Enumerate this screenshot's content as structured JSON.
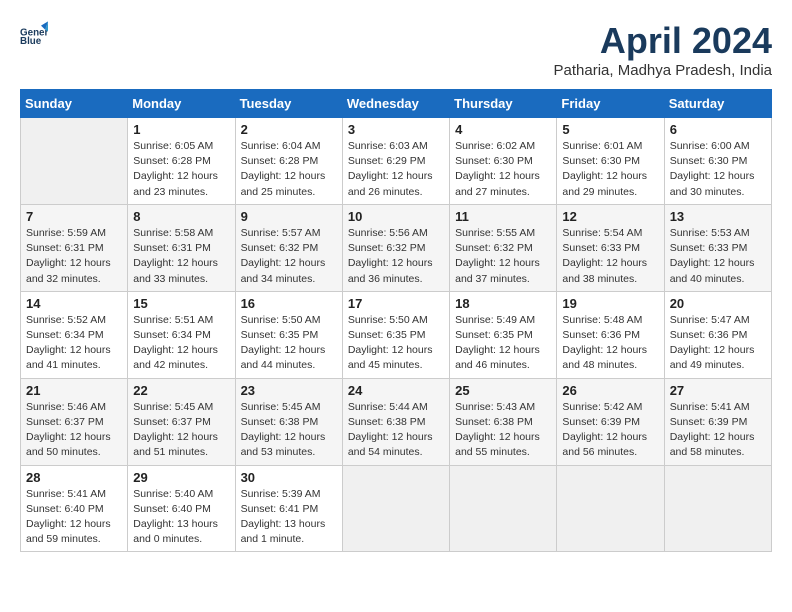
{
  "header": {
    "logo_line1": "General",
    "logo_line2": "Blue",
    "month": "April 2024",
    "location": "Patharia, Madhya Pradesh, India"
  },
  "weekdays": [
    "Sunday",
    "Monday",
    "Tuesday",
    "Wednesday",
    "Thursday",
    "Friday",
    "Saturday"
  ],
  "weeks": [
    [
      {
        "day": "",
        "empty": true
      },
      {
        "day": "1",
        "sunrise": "Sunrise: 6:05 AM",
        "sunset": "Sunset: 6:28 PM",
        "daylight": "Daylight: 12 hours and 23 minutes."
      },
      {
        "day": "2",
        "sunrise": "Sunrise: 6:04 AM",
        "sunset": "Sunset: 6:28 PM",
        "daylight": "Daylight: 12 hours and 25 minutes."
      },
      {
        "day": "3",
        "sunrise": "Sunrise: 6:03 AM",
        "sunset": "Sunset: 6:29 PM",
        "daylight": "Daylight: 12 hours and 26 minutes."
      },
      {
        "day": "4",
        "sunrise": "Sunrise: 6:02 AM",
        "sunset": "Sunset: 6:30 PM",
        "daylight": "Daylight: 12 hours and 27 minutes."
      },
      {
        "day": "5",
        "sunrise": "Sunrise: 6:01 AM",
        "sunset": "Sunset: 6:30 PM",
        "daylight": "Daylight: 12 hours and 29 minutes."
      },
      {
        "day": "6",
        "sunrise": "Sunrise: 6:00 AM",
        "sunset": "Sunset: 6:30 PM",
        "daylight": "Daylight: 12 hours and 30 minutes."
      }
    ],
    [
      {
        "day": "7",
        "sunrise": "Sunrise: 5:59 AM",
        "sunset": "Sunset: 6:31 PM",
        "daylight": "Daylight: 12 hours and 32 minutes."
      },
      {
        "day": "8",
        "sunrise": "Sunrise: 5:58 AM",
        "sunset": "Sunset: 6:31 PM",
        "daylight": "Daylight: 12 hours and 33 minutes."
      },
      {
        "day": "9",
        "sunrise": "Sunrise: 5:57 AM",
        "sunset": "Sunset: 6:32 PM",
        "daylight": "Daylight: 12 hours and 34 minutes."
      },
      {
        "day": "10",
        "sunrise": "Sunrise: 5:56 AM",
        "sunset": "Sunset: 6:32 PM",
        "daylight": "Daylight: 12 hours and 36 minutes."
      },
      {
        "day": "11",
        "sunrise": "Sunrise: 5:55 AM",
        "sunset": "Sunset: 6:32 PM",
        "daylight": "Daylight: 12 hours and 37 minutes."
      },
      {
        "day": "12",
        "sunrise": "Sunrise: 5:54 AM",
        "sunset": "Sunset: 6:33 PM",
        "daylight": "Daylight: 12 hours and 38 minutes."
      },
      {
        "day": "13",
        "sunrise": "Sunrise: 5:53 AM",
        "sunset": "Sunset: 6:33 PM",
        "daylight": "Daylight: 12 hours and 40 minutes."
      }
    ],
    [
      {
        "day": "14",
        "sunrise": "Sunrise: 5:52 AM",
        "sunset": "Sunset: 6:34 PM",
        "daylight": "Daylight: 12 hours and 41 minutes."
      },
      {
        "day": "15",
        "sunrise": "Sunrise: 5:51 AM",
        "sunset": "Sunset: 6:34 PM",
        "daylight": "Daylight: 12 hours and 42 minutes."
      },
      {
        "day": "16",
        "sunrise": "Sunrise: 5:50 AM",
        "sunset": "Sunset: 6:35 PM",
        "daylight": "Daylight: 12 hours and 44 minutes."
      },
      {
        "day": "17",
        "sunrise": "Sunrise: 5:50 AM",
        "sunset": "Sunset: 6:35 PM",
        "daylight": "Daylight: 12 hours and 45 minutes."
      },
      {
        "day": "18",
        "sunrise": "Sunrise: 5:49 AM",
        "sunset": "Sunset: 6:35 PM",
        "daylight": "Daylight: 12 hours and 46 minutes."
      },
      {
        "day": "19",
        "sunrise": "Sunrise: 5:48 AM",
        "sunset": "Sunset: 6:36 PM",
        "daylight": "Daylight: 12 hours and 48 minutes."
      },
      {
        "day": "20",
        "sunrise": "Sunrise: 5:47 AM",
        "sunset": "Sunset: 6:36 PM",
        "daylight": "Daylight: 12 hours and 49 minutes."
      }
    ],
    [
      {
        "day": "21",
        "sunrise": "Sunrise: 5:46 AM",
        "sunset": "Sunset: 6:37 PM",
        "daylight": "Daylight: 12 hours and 50 minutes."
      },
      {
        "day": "22",
        "sunrise": "Sunrise: 5:45 AM",
        "sunset": "Sunset: 6:37 PM",
        "daylight": "Daylight: 12 hours and 51 minutes."
      },
      {
        "day": "23",
        "sunrise": "Sunrise: 5:45 AM",
        "sunset": "Sunset: 6:38 PM",
        "daylight": "Daylight: 12 hours and 53 minutes."
      },
      {
        "day": "24",
        "sunrise": "Sunrise: 5:44 AM",
        "sunset": "Sunset: 6:38 PM",
        "daylight": "Daylight: 12 hours and 54 minutes."
      },
      {
        "day": "25",
        "sunrise": "Sunrise: 5:43 AM",
        "sunset": "Sunset: 6:38 PM",
        "daylight": "Daylight: 12 hours and 55 minutes."
      },
      {
        "day": "26",
        "sunrise": "Sunrise: 5:42 AM",
        "sunset": "Sunset: 6:39 PM",
        "daylight": "Daylight: 12 hours and 56 minutes."
      },
      {
        "day": "27",
        "sunrise": "Sunrise: 5:41 AM",
        "sunset": "Sunset: 6:39 PM",
        "daylight": "Daylight: 12 hours and 58 minutes."
      }
    ],
    [
      {
        "day": "28",
        "sunrise": "Sunrise: 5:41 AM",
        "sunset": "Sunset: 6:40 PM",
        "daylight": "Daylight: 12 hours and 59 minutes."
      },
      {
        "day": "29",
        "sunrise": "Sunrise: 5:40 AM",
        "sunset": "Sunset: 6:40 PM",
        "daylight": "Daylight: 13 hours and 0 minutes."
      },
      {
        "day": "30",
        "sunrise": "Sunrise: 5:39 AM",
        "sunset": "Sunset: 6:41 PM",
        "daylight": "Daylight: 13 hours and 1 minute."
      },
      {
        "day": "",
        "empty": true
      },
      {
        "day": "",
        "empty": true
      },
      {
        "day": "",
        "empty": true
      },
      {
        "day": "",
        "empty": true
      }
    ]
  ]
}
